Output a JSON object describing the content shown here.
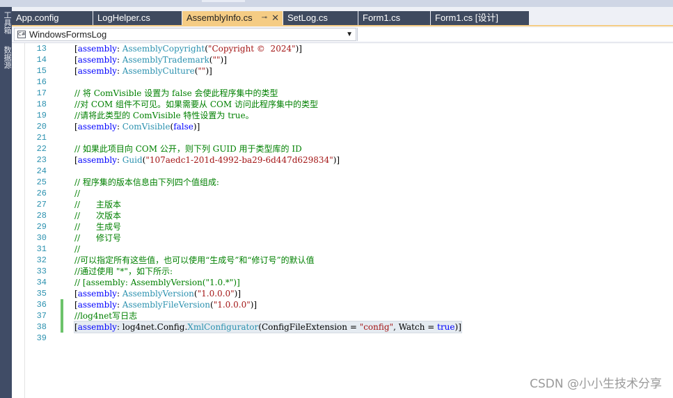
{
  "left_toolbar": {
    "labels": [
      "工具箱",
      "数据源"
    ]
  },
  "tabs": [
    {
      "label": "App.config"
    },
    {
      "label": "LogHelper.cs"
    },
    {
      "label": "AssemblyInfo.cs",
      "active": true
    },
    {
      "label": "SetLog.cs"
    },
    {
      "label": "Form1.cs"
    },
    {
      "label": "Form1.cs [设计]"
    }
  ],
  "tab_icons": {
    "pin": "pin-icon",
    "close": "close-icon"
  },
  "nav": {
    "project": "WindowsFormsLog",
    "project_icon": "csharp-project-icon",
    "arrow_icon": "chevron-down-icon"
  },
  "colors": {
    "keyword": "#0000ff",
    "type": "#2b91af",
    "string": "#a31515",
    "comment": "#008000",
    "active_tab": "#f5cc84",
    "inactive_tab": "#3f4a5f",
    "change_marker": "#6cc36b"
  },
  "editor": {
    "lines": [
      {
        "n": "13",
        "segs": [
          {
            "t": "["
          },
          {
            "t": "assembly",
            "k": "k"
          },
          {
            "t": ": "
          },
          {
            "t": "AssemblyCopyright",
            "k": "t"
          },
          {
            "t": "("
          },
          {
            "t": "\"Copyright ©  2024\"",
            "k": "s"
          },
          {
            "t": ")]"
          }
        ]
      },
      {
        "n": "14",
        "segs": [
          {
            "t": "["
          },
          {
            "t": "assembly",
            "k": "k"
          },
          {
            "t": ": "
          },
          {
            "t": "AssemblyTrademark",
            "k": "t"
          },
          {
            "t": "("
          },
          {
            "t": "\"\"",
            "k": "s"
          },
          {
            "t": ")]"
          }
        ]
      },
      {
        "n": "15",
        "segs": [
          {
            "t": "["
          },
          {
            "t": "assembly",
            "k": "k"
          },
          {
            "t": ": "
          },
          {
            "t": "AssemblyCulture",
            "k": "t"
          },
          {
            "t": "("
          },
          {
            "t": "\"\"",
            "k": "s"
          },
          {
            "t": ")]"
          }
        ]
      },
      {
        "n": "16",
        "segs": []
      },
      {
        "n": "17",
        "segs": [
          {
            "t": "// 将 ComVisible 设置为 false 会使此程序集中的类型",
            "k": "c"
          }
        ]
      },
      {
        "n": "18",
        "segs": [
          {
            "t": "//对 COM 组件不可见。如果需要从 COM 访问此程序集中的类型",
            "k": "c"
          }
        ]
      },
      {
        "n": "19",
        "segs": [
          {
            "t": "//请将此类型的 ComVisible 特性设置为 true。",
            "k": "c"
          }
        ]
      },
      {
        "n": "20",
        "segs": [
          {
            "t": "["
          },
          {
            "t": "assembly",
            "k": "k"
          },
          {
            "t": ": "
          },
          {
            "t": "ComVisible",
            "k": "t"
          },
          {
            "t": "("
          },
          {
            "t": "false",
            "k": "k"
          },
          {
            "t": ")]"
          }
        ]
      },
      {
        "n": "21",
        "segs": []
      },
      {
        "n": "22",
        "segs": [
          {
            "t": "// 如果此项目向 COM 公开，则下列 GUID 用于类型库的 ID",
            "k": "c"
          }
        ]
      },
      {
        "n": "23",
        "segs": [
          {
            "t": "["
          },
          {
            "t": "assembly",
            "k": "k"
          },
          {
            "t": ": "
          },
          {
            "t": "Guid",
            "k": "t"
          },
          {
            "t": "("
          },
          {
            "t": "\"107aedc1-201d-4992-ba29-6d447d629834\"",
            "k": "s"
          },
          {
            "t": ")]"
          }
        ]
      },
      {
        "n": "24",
        "segs": []
      },
      {
        "n": "25",
        "segs": [
          {
            "t": "// 程序集的版本信息由下列四个值组成:",
            "k": "c"
          }
        ]
      },
      {
        "n": "26",
        "segs": [
          {
            "t": "//",
            "k": "c"
          }
        ]
      },
      {
        "n": "27",
        "segs": [
          {
            "t": "//      主版本",
            "k": "c"
          }
        ]
      },
      {
        "n": "28",
        "segs": [
          {
            "t": "//      次版本",
            "k": "c"
          }
        ]
      },
      {
        "n": "29",
        "segs": [
          {
            "t": "//      生成号",
            "k": "c"
          }
        ]
      },
      {
        "n": "30",
        "segs": [
          {
            "t": "//      修订号",
            "k": "c"
          }
        ]
      },
      {
        "n": "31",
        "segs": [
          {
            "t": "//",
            "k": "c"
          }
        ]
      },
      {
        "n": "32",
        "segs": [
          {
            "t": "//可以指定所有这些值，也可以使用“生成号”和“修订号”的默认值",
            "k": "c"
          }
        ]
      },
      {
        "n": "33",
        "segs": [
          {
            "t": "//通过使用 \"*\"，如下所示:",
            "k": "c"
          }
        ]
      },
      {
        "n": "34",
        "segs": [
          {
            "t": "// [assembly: AssemblyVersion(\"1.0.*\")]",
            "k": "c"
          }
        ]
      },
      {
        "n": "35",
        "segs": [
          {
            "t": "["
          },
          {
            "t": "assembly",
            "k": "k"
          },
          {
            "t": ": "
          },
          {
            "t": "AssemblyVersion",
            "k": "t"
          },
          {
            "t": "("
          },
          {
            "t": "\"1.0.0.0\"",
            "k": "s"
          },
          {
            "t": ")]"
          }
        ]
      },
      {
        "n": "36",
        "changed": true,
        "segs": [
          {
            "t": "["
          },
          {
            "t": "assembly",
            "k": "k"
          },
          {
            "t": ": "
          },
          {
            "t": "AssemblyFileVersion",
            "k": "t"
          },
          {
            "t": "("
          },
          {
            "t": "\"1.0.0.0\"",
            "k": "s"
          },
          {
            "t": ")]"
          }
        ]
      },
      {
        "n": "37",
        "changed": true,
        "segs": [
          {
            "t": "//log4net写日志",
            "k": "c"
          }
        ]
      },
      {
        "n": "38",
        "changed": true,
        "selected": true,
        "segs": [
          {
            "t": "["
          },
          {
            "t": "assembly",
            "k": "k"
          },
          {
            "t": ": log4net.Config."
          },
          {
            "t": "XmlConfigurator",
            "k": "t"
          },
          {
            "t": "(ConfigFileExtension = "
          },
          {
            "t": "\"config\"",
            "k": "s"
          },
          {
            "t": ", Watch = "
          },
          {
            "t": "true",
            "k": "k"
          },
          {
            "t": ")]"
          }
        ]
      },
      {
        "n": "39",
        "segs": []
      }
    ]
  },
  "watermark": "CSDN @小小生技术分享"
}
